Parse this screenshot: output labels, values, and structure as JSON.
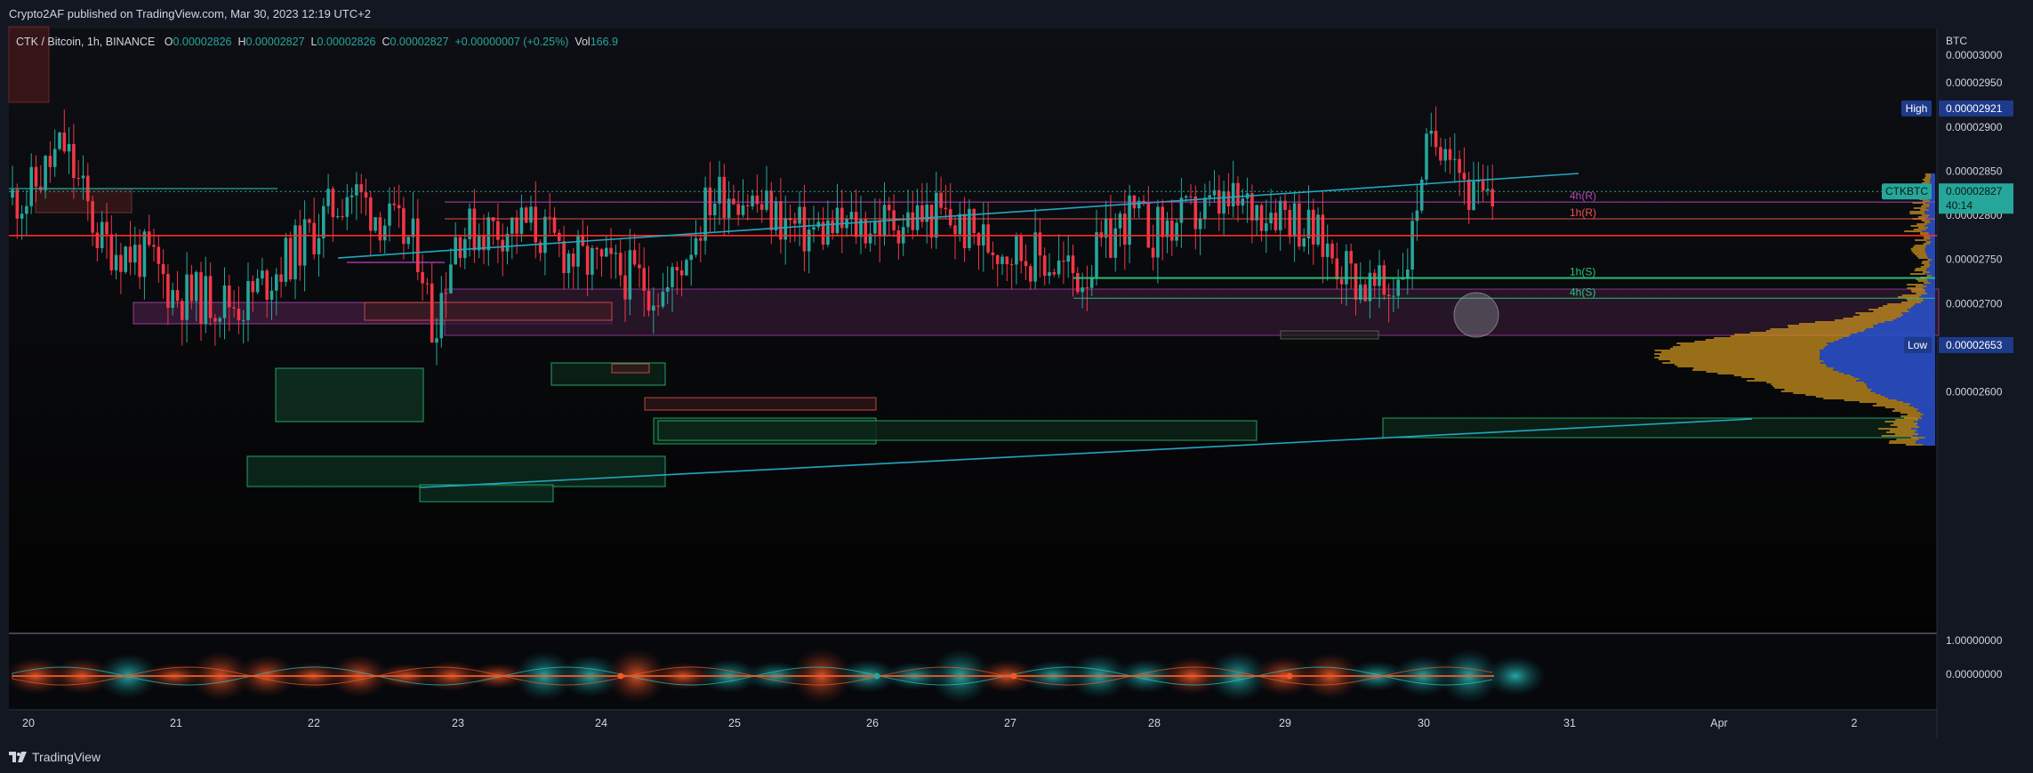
{
  "header": {
    "published": "Crypto2AF published on TradingView.com, Mar 30, 2023 12:19 UTC+2"
  },
  "symbol": {
    "name": "CTK / Bitcoin, 1h, BINANCE",
    "o_label": "O",
    "o": "0.00002826",
    "h_label": "H",
    "h": "0.00002827",
    "l_label": "L",
    "l": "0.00002826",
    "c_label": "C",
    "c": "0.00002827",
    "change": "+0.00000007 (+0.25%)",
    "vol_label": "Vol",
    "vol": "166.9"
  },
  "price_axis": {
    "currency": "BTC",
    "ticks": [
      "0.00003000",
      "0.00002950",
      "0.00002900",
      "0.00002850",
      "0.00002800",
      "0.00002750",
      "0.00002700",
      "0.00002650",
      "0.00002600"
    ]
  },
  "badges": {
    "high_label": "High",
    "high_value": "0.00002921",
    "low_label": "Low",
    "low_value": "0.00002653",
    "ticker": "CTKBTC",
    "last_price": "0.00002827",
    "countdown": "40:14"
  },
  "levels": {
    "h4r": "4h(R)",
    "h1r": "1h(R)",
    "h1s": "1h(S)",
    "h4s": "4h(S)"
  },
  "oscillator": {
    "ticks": [
      "1.00000000",
      "0.00000000"
    ]
  },
  "time_axis": [
    "20",
    "21",
    "22",
    "23",
    "24",
    "25",
    "26",
    "27",
    "28",
    "29",
    "30",
    "31",
    "Apr",
    "2"
  ],
  "footer": {
    "brand": "TradingView"
  },
  "colors": {
    "up": "#26a69a",
    "down": "#ef5350",
    "trendline": "#22a7c0",
    "support": "#27c67a",
    "resistance": "#ef5350",
    "bg": "#0a0a0f"
  },
  "chart_data": {
    "type": "candlestick",
    "title": "CTK / Bitcoin, 1h, BINANCE",
    "y_unit": "BTC",
    "ylim": [
      2.55e-05,
      3.005e-05
    ],
    "x_start": "2023-03-20",
    "x_end": "2023-04-02",
    "high": 2.921e-05,
    "low": 2.653e-05,
    "last": 2.827e-05,
    "horizontal_levels": [
      {
        "label": "4h(R)",
        "value": 2.815e-05
      },
      {
        "label": "1h(R)",
        "value": 2.796e-05
      },
      {
        "label": "1h(S)",
        "value": 2.729e-05
      },
      {
        "label": "4h(S)",
        "value": 2.706e-05
      }
    ],
    "red_line": 2.777e-05,
    "anchor_closes": [
      {
        "x": "2023-03-20 00:00",
        "y": 2.82e-05
      },
      {
        "x": "2023-03-20 06:00",
        "y": 2.88e-05
      },
      {
        "x": "2023-03-20 12:00",
        "y": 2.77e-05
      },
      {
        "x": "2023-03-20 20:00",
        "y": 2.75e-05
      },
      {
        "x": "2023-03-21 00:00",
        "y": 2.71e-05
      },
      {
        "x": "2023-03-21 12:00",
        "y": 2.7e-05
      },
      {
        "x": "2023-03-22 00:00",
        "y": 2.78e-05
      },
      {
        "x": "2023-03-22 06:00",
        "y": 2.83e-05
      },
      {
        "x": "2023-03-22 18:00",
        "y": 2.76e-05
      },
      {
        "x": "2023-03-22 20:00",
        "y": 2.67e-05
      },
      {
        "x": "2023-03-23 00:00",
        "y": 2.78e-05
      },
      {
        "x": "2023-03-23 12:00",
        "y": 2.79e-05
      },
      {
        "x": "2023-03-23 20:00",
        "y": 2.75e-05
      },
      {
        "x": "2023-03-24 06:00",
        "y": 2.73e-05
      },
      {
        "x": "2023-03-24 12:00",
        "y": 2.71e-05
      },
      {
        "x": "2023-03-24 20:00",
        "y": 2.82e-05
      },
      {
        "x": "2023-03-25 00:00",
        "y": 2.83e-05
      },
      {
        "x": "2023-03-25 12:00",
        "y": 2.78e-05
      },
      {
        "x": "2023-03-26 00:00",
        "y": 2.79e-05
      },
      {
        "x": "2023-03-26 12:00",
        "y": 2.8e-05
      },
      {
        "x": "2023-03-26 20:00",
        "y": 2.77e-05
      },
      {
        "x": "2023-03-27 06:00",
        "y": 2.75e-05
      },
      {
        "x": "2023-03-27 12:00",
        "y": 2.73e-05
      },
      {
        "x": "2023-03-27 20:00",
        "y": 2.8e-05
      },
      {
        "x": "2023-03-28 00:00",
        "y": 2.78e-05
      },
      {
        "x": "2023-03-28 12:00",
        "y": 2.81e-05
      },
      {
        "x": "2023-03-29 00:00",
        "y": 2.81e-05
      },
      {
        "x": "2023-03-29 08:00",
        "y": 2.76e-05
      },
      {
        "x": "2023-03-29 14:00",
        "y": 2.72e-05
      },
      {
        "x": "2023-03-29 18:00",
        "y": 2.71e-05
      },
      {
        "x": "2023-03-29 22:00",
        "y": 2.76e-05
      },
      {
        "x": "2023-03-30 00:00",
        "y": 2.86e-05
      },
      {
        "x": "2023-03-30 04:00",
        "y": 2.9e-05
      },
      {
        "x": "2023-03-30 08:00",
        "y": 2.82e-05
      },
      {
        "x": "2023-03-30 12:00",
        "y": 2.81e-05
      },
      {
        "x": "2023-03-30 16:00",
        "y": 2.83e-05
      }
    ]
  }
}
